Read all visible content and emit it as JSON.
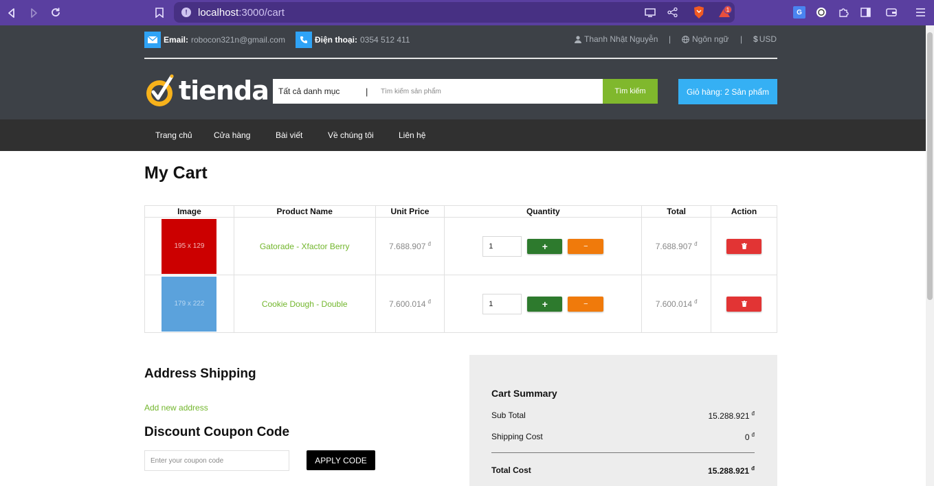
{
  "browser": {
    "url_host": "localhost",
    "url_path": ":3000/cart",
    "notification_count": "1"
  },
  "header": {
    "email_label": "Email:",
    "email_value": "robocon321n@gmail.com",
    "phone_label": "Điện thoại:",
    "phone_value": "0354 512 411",
    "user_name": "Thanh Nhật Nguyễn",
    "language": "Ngôn ngữ",
    "currency": "USD",
    "logo_text": "tienda",
    "search_category": "Tất cả danh mục",
    "search_divider": "|",
    "search_placeholder": "Tìm kiếm sản phẩm",
    "search_button": "Tìm kiếm",
    "cart_button": "Giỏ hàng: 2 Sản phẩm"
  },
  "menu": [
    "Trang chủ",
    "Cửa hàng",
    "Bài viết",
    "Về chúng tôi",
    "Liên hệ"
  ],
  "page_title": "My Cart",
  "table": {
    "headers": [
      "Image",
      "Product Name",
      "Unit Price",
      "Quantity",
      "Total",
      "Action"
    ],
    "rows": [
      {
        "image_label": "195 x 129",
        "image_color": "#cc0000",
        "name": "Gatorade - Xfactor Berry",
        "unit_price": "7.688.907",
        "quantity": "1",
        "total": "7.688.907"
      },
      {
        "image_label": "179 x 222",
        "image_color": "#5ba2dc",
        "name": "Cookie Dough - Double",
        "unit_price": "7.600.014",
        "quantity": "1",
        "total": "7.600.014"
      }
    ],
    "currency_symbol": "đ",
    "plus_symbol": "+",
    "minus_symbol": "−"
  },
  "address": {
    "title": "Address Shipping",
    "add_link": "Add new address"
  },
  "coupon": {
    "title": "Discount Coupon Code",
    "placeholder": "Enter your coupon code",
    "apply_label": "APPLY CODE"
  },
  "summary": {
    "title": "Cart Summary",
    "subtotal_label": "Sub Total",
    "subtotal_value": "15.288.921",
    "shipping_label": "Shipping Cost",
    "shipping_value": "0",
    "total_label": "Total Cost",
    "total_value": "15.288.921",
    "currency_symbol": "đ"
  },
  "colors": {
    "accent_green": "#72b62c",
    "cart_blue": "#35b0f4",
    "header_dark": "#3d4147",
    "menu_dark": "#303030",
    "browser_purple": "#5a3fa0"
  }
}
